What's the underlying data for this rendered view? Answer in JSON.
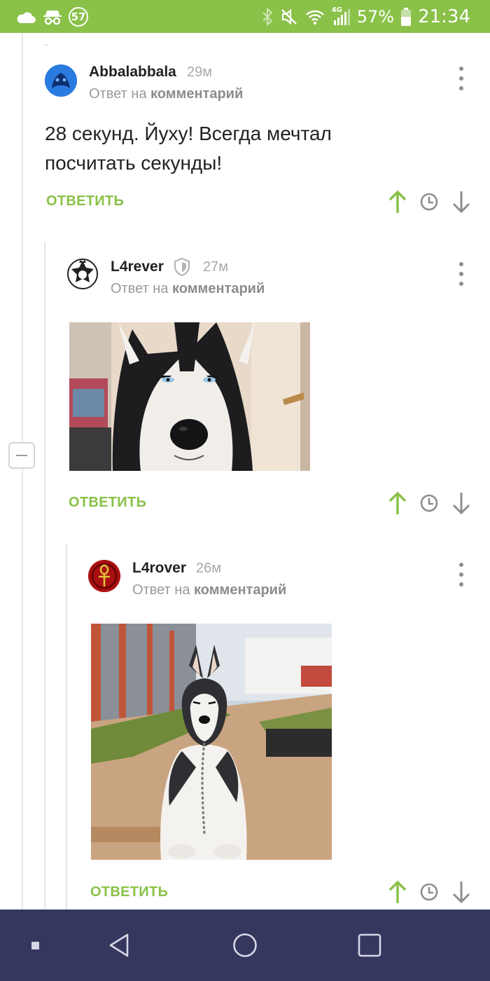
{
  "status_bar": {
    "notification_count": "57",
    "battery_percent": "57%",
    "time": "21:34",
    "network": "4G",
    "icons": [
      "cloud-icon",
      "incognito-icon",
      "bluetooth-icon",
      "mute-icon",
      "wifi-icon",
      "signal-icon",
      "battery-icon"
    ]
  },
  "comments": [
    {
      "author": "Abbalabbala",
      "time": "29м",
      "reply_prefix": "Ответ на",
      "reply_target": "комментарий",
      "text_line1": "28 секунд. Йуху! Всегда мечтал",
      "text_line2": "посчитать секунды!",
      "reply_label": "ОТВЕТИТЬ"
    },
    {
      "author": "L4rever",
      "time": "27м",
      "reply_prefix": "Ответ на",
      "reply_target": "комментарий",
      "image": "photo of an angry-looking husky dog (close-up)",
      "reply_label": "ОТВЕТИТЬ",
      "badge_icon": "shield-icon"
    },
    {
      "author": "L4rover",
      "time": "26м",
      "reply_prefix": "Ответ на",
      "reply_target": "комментарий",
      "image": "photo of a husky sitting on a chain outdoors, eyes squinting",
      "reply_label": "ОТВЕТИТЬ"
    }
  ],
  "colors": {
    "accent_green": "#8ac149",
    "nav_bar": "#36375e",
    "muted_gray": "#9a9a9a"
  },
  "nav_bar": {
    "icons": [
      "recent-dot-icon",
      "back-icon",
      "home-icon",
      "overview-icon"
    ]
  }
}
